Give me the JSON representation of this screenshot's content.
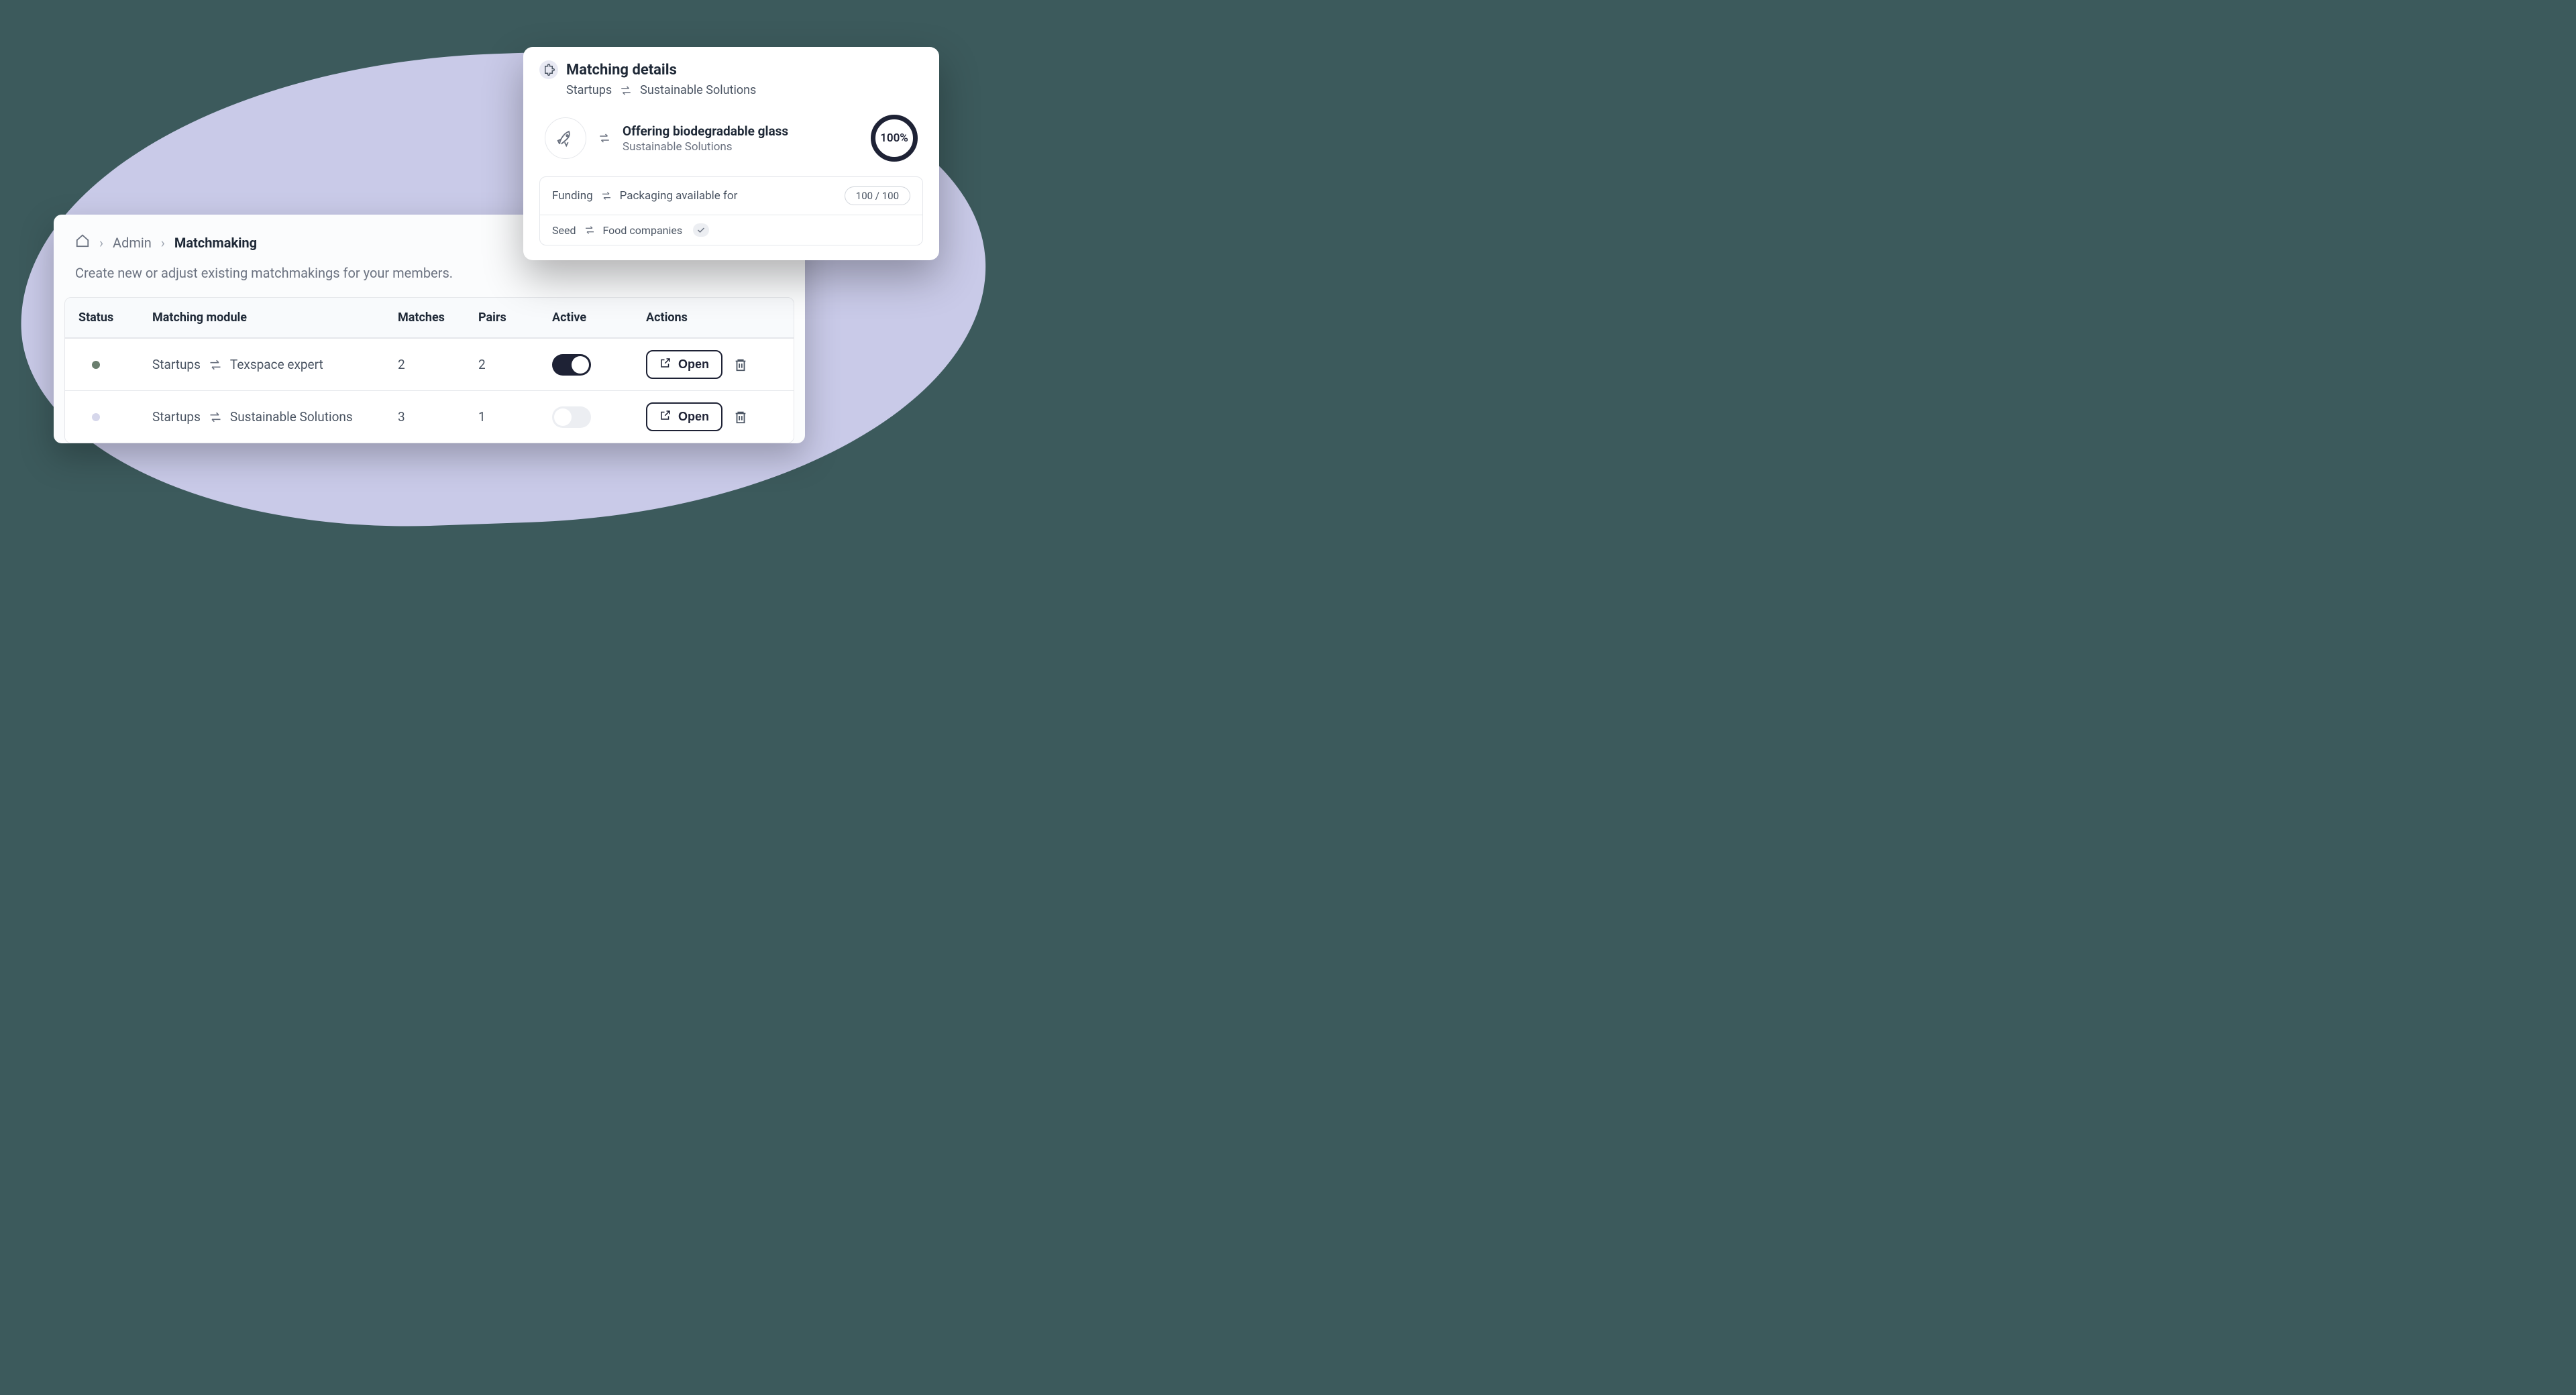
{
  "breadcrumb": {
    "admin": "Admin",
    "current": "Matchmaking"
  },
  "subtitle": "Create new or adjust existing matchmakings for your members.",
  "table": {
    "headers": {
      "status": "Status",
      "module": "Matching module",
      "matches": "Matches",
      "pairs": "Pairs",
      "active": "Active",
      "actions": "Actions"
    },
    "rows": [
      {
        "module_left": "Startups",
        "module_right": "Texspace expert",
        "matches": "2",
        "pairs": "2",
        "open": "Open"
      },
      {
        "module_left": "Startups",
        "module_right": "Sustainable Solutions",
        "matches": "3",
        "pairs": "1",
        "open": "Open"
      }
    ]
  },
  "details": {
    "title": "Matching details",
    "sub_left": "Startups",
    "sub_right": "Sustainable Solutions",
    "match": {
      "headline": "Offering biodegradable glass",
      "sub": "Sustainable Solutions",
      "pct": "100%"
    },
    "line1": {
      "left": "Funding",
      "right": "Packaging available for",
      "score": "100 / 100"
    },
    "line2": {
      "left": "Seed",
      "right": "Food companies"
    }
  }
}
